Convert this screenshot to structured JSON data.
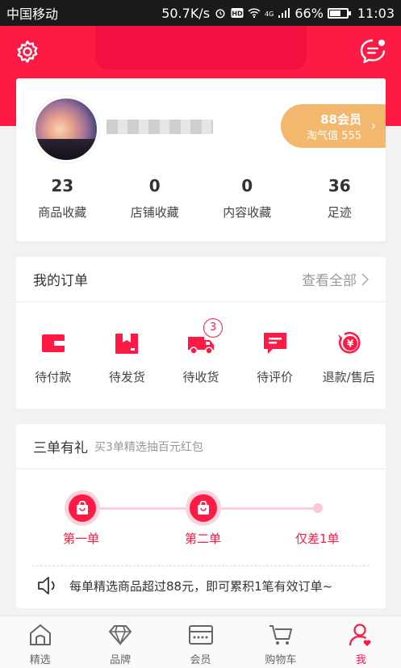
{
  "status_bar": {
    "carrier": "中国移动",
    "speed": "50.7K/s",
    "network": "4G",
    "battery": "66%",
    "time": "11:03"
  },
  "profile": {
    "vip_title": "88会员",
    "vip_sub": "淘气值 555",
    "stats": [
      {
        "value": "23",
        "label": "商品收藏"
      },
      {
        "value": "0",
        "label": "店铺收藏"
      },
      {
        "value": "0",
        "label": "内容收藏"
      },
      {
        "value": "36",
        "label": "足迹"
      }
    ]
  },
  "orders": {
    "title": "我的订单",
    "view_all": "查看全部",
    "items": [
      {
        "label": "待付款",
        "icon": "wallet-icon"
      },
      {
        "label": "待发货",
        "icon": "package-icon"
      },
      {
        "label": "待收货",
        "icon": "truck-icon",
        "badge": "3"
      },
      {
        "label": "待评价",
        "icon": "comment-icon"
      },
      {
        "label": "退款/售后",
        "icon": "refund-icon"
      }
    ]
  },
  "promo": {
    "title": "三单有礼",
    "subtitle": "买3单精选抽百元红包",
    "steps": [
      "第一单",
      "第二单",
      "仅差1单"
    ],
    "notice": "每单精选商品超过88元，即可累积1笔有效订单~"
  },
  "tabbar": [
    {
      "label": "精选",
      "icon": "home-icon"
    },
    {
      "label": "品牌",
      "icon": "diamond-icon"
    },
    {
      "label": "会员",
      "icon": "card-icon"
    },
    {
      "label": "购物车",
      "icon": "cart-icon"
    },
    {
      "label": "我",
      "icon": "person-icon",
      "active": true
    }
  ],
  "colors": {
    "accent": "#ff1a45",
    "vip": "#f4b76e"
  }
}
